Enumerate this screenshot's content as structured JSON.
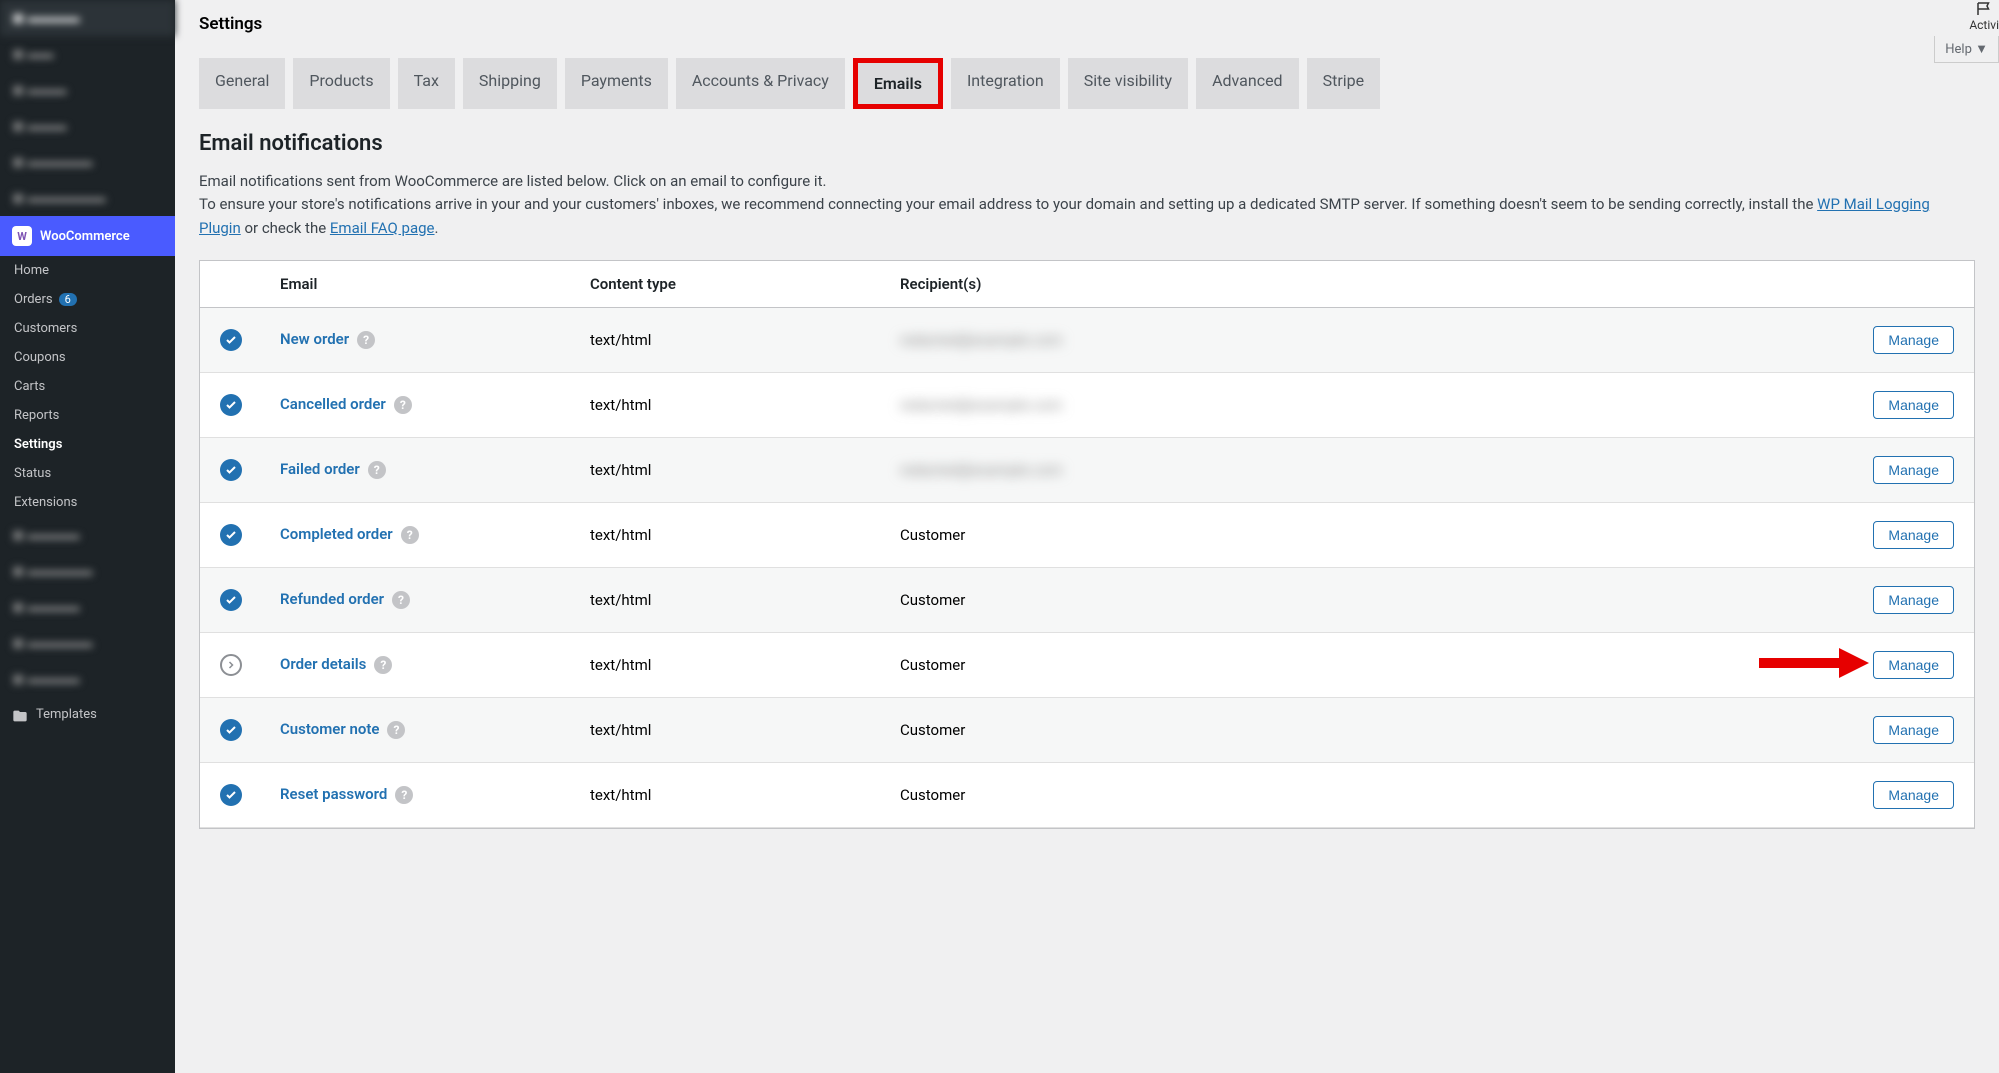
{
  "sidebar": {
    "blurred_top": [
      {
        "label": "Dashboard"
      },
      {
        "label": "Posts"
      },
      {
        "label": "Media"
      },
      {
        "label": "Pages"
      },
      {
        "label": "Comments"
      },
      {
        "label": "WooCommerce"
      }
    ],
    "main_item": "WooCommerce",
    "sub_items": [
      {
        "label": "Home"
      },
      {
        "label": "Orders",
        "badge": "6"
      },
      {
        "label": "Customers"
      },
      {
        "label": "Coupons"
      },
      {
        "label": "Carts"
      },
      {
        "label": "Reports"
      },
      {
        "label": "Settings",
        "active": true
      },
      {
        "label": "Status"
      },
      {
        "label": "Extensions"
      }
    ],
    "blurred_bottom": [
      {
        "label": "Products"
      },
      {
        "label": "Payments"
      },
      {
        "label": "Analytics"
      },
      {
        "label": "Marketing"
      },
      {
        "label": "Elementor"
      }
    ],
    "templates": "Templates"
  },
  "header": {
    "page_title": "Settings",
    "activity": "Activi",
    "help": "Help"
  },
  "tabs": [
    {
      "label": "General"
    },
    {
      "label": "Products"
    },
    {
      "label": "Tax"
    },
    {
      "label": "Shipping"
    },
    {
      "label": "Payments"
    },
    {
      "label": "Accounts & Privacy"
    },
    {
      "label": "Emails",
      "active": true
    },
    {
      "label": "Integration"
    },
    {
      "label": "Site visibility"
    },
    {
      "label": "Advanced"
    },
    {
      "label": "Stripe"
    }
  ],
  "section": {
    "title": "Email notifications",
    "desc1": "Email notifications sent from WooCommerce are listed below. Click on an email to configure it.",
    "desc2a": "To ensure your store's notifications arrive in your and your customers' inboxes, we recommend connecting your email address to your domain and setting up a dedicated SMTP server. If something doesn't seem to be sending correctly, install the ",
    "link1": "WP Mail Logging Plugin",
    "desc2b": " or check the ",
    "link2": "Email FAQ page",
    "desc2c": "."
  },
  "table": {
    "headers": {
      "email": "Email",
      "type": "Content type",
      "recipient": "Recipient(s)"
    },
    "manage_label": "Manage",
    "rows": [
      {
        "status": "enabled",
        "name": "New order",
        "type": "text/html",
        "recipient": "redacted@example.com",
        "redacted": true
      },
      {
        "status": "enabled",
        "name": "Cancelled order",
        "type": "text/html",
        "recipient": "redacted@example.com",
        "redacted": true
      },
      {
        "status": "enabled",
        "name": "Failed order",
        "type": "text/html",
        "recipient": "redacted@example.com",
        "redacted": true
      },
      {
        "status": "enabled",
        "name": "Completed order",
        "type": "text/html",
        "recipient": "Customer"
      },
      {
        "status": "enabled",
        "name": "Refunded order",
        "type": "text/html",
        "recipient": "Customer"
      },
      {
        "status": "manual",
        "name": "Order details",
        "type": "text/html",
        "recipient": "Customer",
        "arrow": true
      },
      {
        "status": "enabled",
        "name": "Customer note",
        "type": "text/html",
        "recipient": "Customer"
      },
      {
        "status": "enabled",
        "name": "Reset password",
        "type": "text/html",
        "recipient": "Customer"
      }
    ]
  }
}
